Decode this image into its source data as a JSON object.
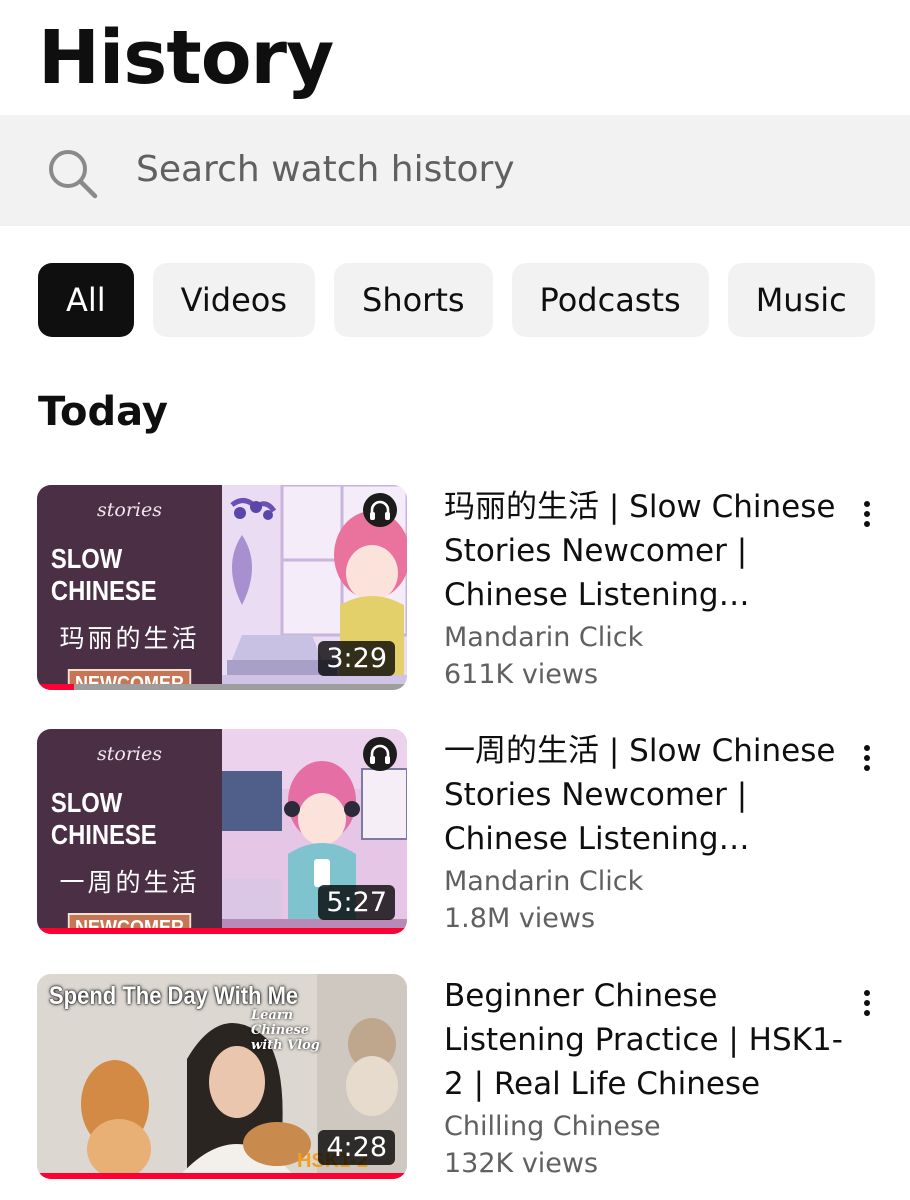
{
  "page": {
    "title": "History"
  },
  "search": {
    "placeholder": "Search watch history"
  },
  "chips": [
    {
      "label": "All",
      "active": true
    },
    {
      "label": "Videos",
      "active": false
    },
    {
      "label": "Shorts",
      "active": false
    },
    {
      "label": "Podcasts",
      "active": false
    },
    {
      "label": "Music",
      "active": false
    }
  ],
  "section": {
    "title": "Today"
  },
  "videos": [
    {
      "title": "玛丽的生活 | Slow Chinese Stories Newcomer | Chinese Listening Practice",
      "channel": "Mandarin Click",
      "views": "611K views",
      "duration": "3:29",
      "watched_fraction": 0.1,
      "thumb": {
        "tag": "stories",
        "headline": "SLOW CHINESE",
        "subtitle": "玛丽的生活",
        "badge": "NEWCOMER",
        "scene": "cafe-girl-laptop"
      }
    },
    {
      "title": "一周的生活 | Slow Chinese Stories Newcomer | Chinese Listening Practice",
      "channel": "Mandarin Click",
      "views": "1.8M views",
      "duration": "5:27",
      "watched_fraction": 1.0,
      "thumb": {
        "tag": "stories",
        "headline": "SLOW CHINESE",
        "subtitle": "一周的生活",
        "badge": "NEWCOMER",
        "scene": "coffee-shop-girl"
      }
    },
    {
      "title": "Beginner Chinese Listening Practice | HSK1-2 | Real Life Chinese",
      "channel": "Chilling Chinese",
      "views": "132K views",
      "duration": "4:28",
      "watched_fraction": 1.0,
      "thumb": {
        "headline": "Spend The Day With Me",
        "caption": "Learn Chinese with Vlog",
        "corner": "HSK1-2",
        "scene": "girl-with-cats"
      }
    }
  ],
  "colors": {
    "accent": "#ff0033",
    "chip_bg": "#f2f2f2",
    "chip_active_bg": "#0f0f0f",
    "secondary_text": "#606060"
  }
}
